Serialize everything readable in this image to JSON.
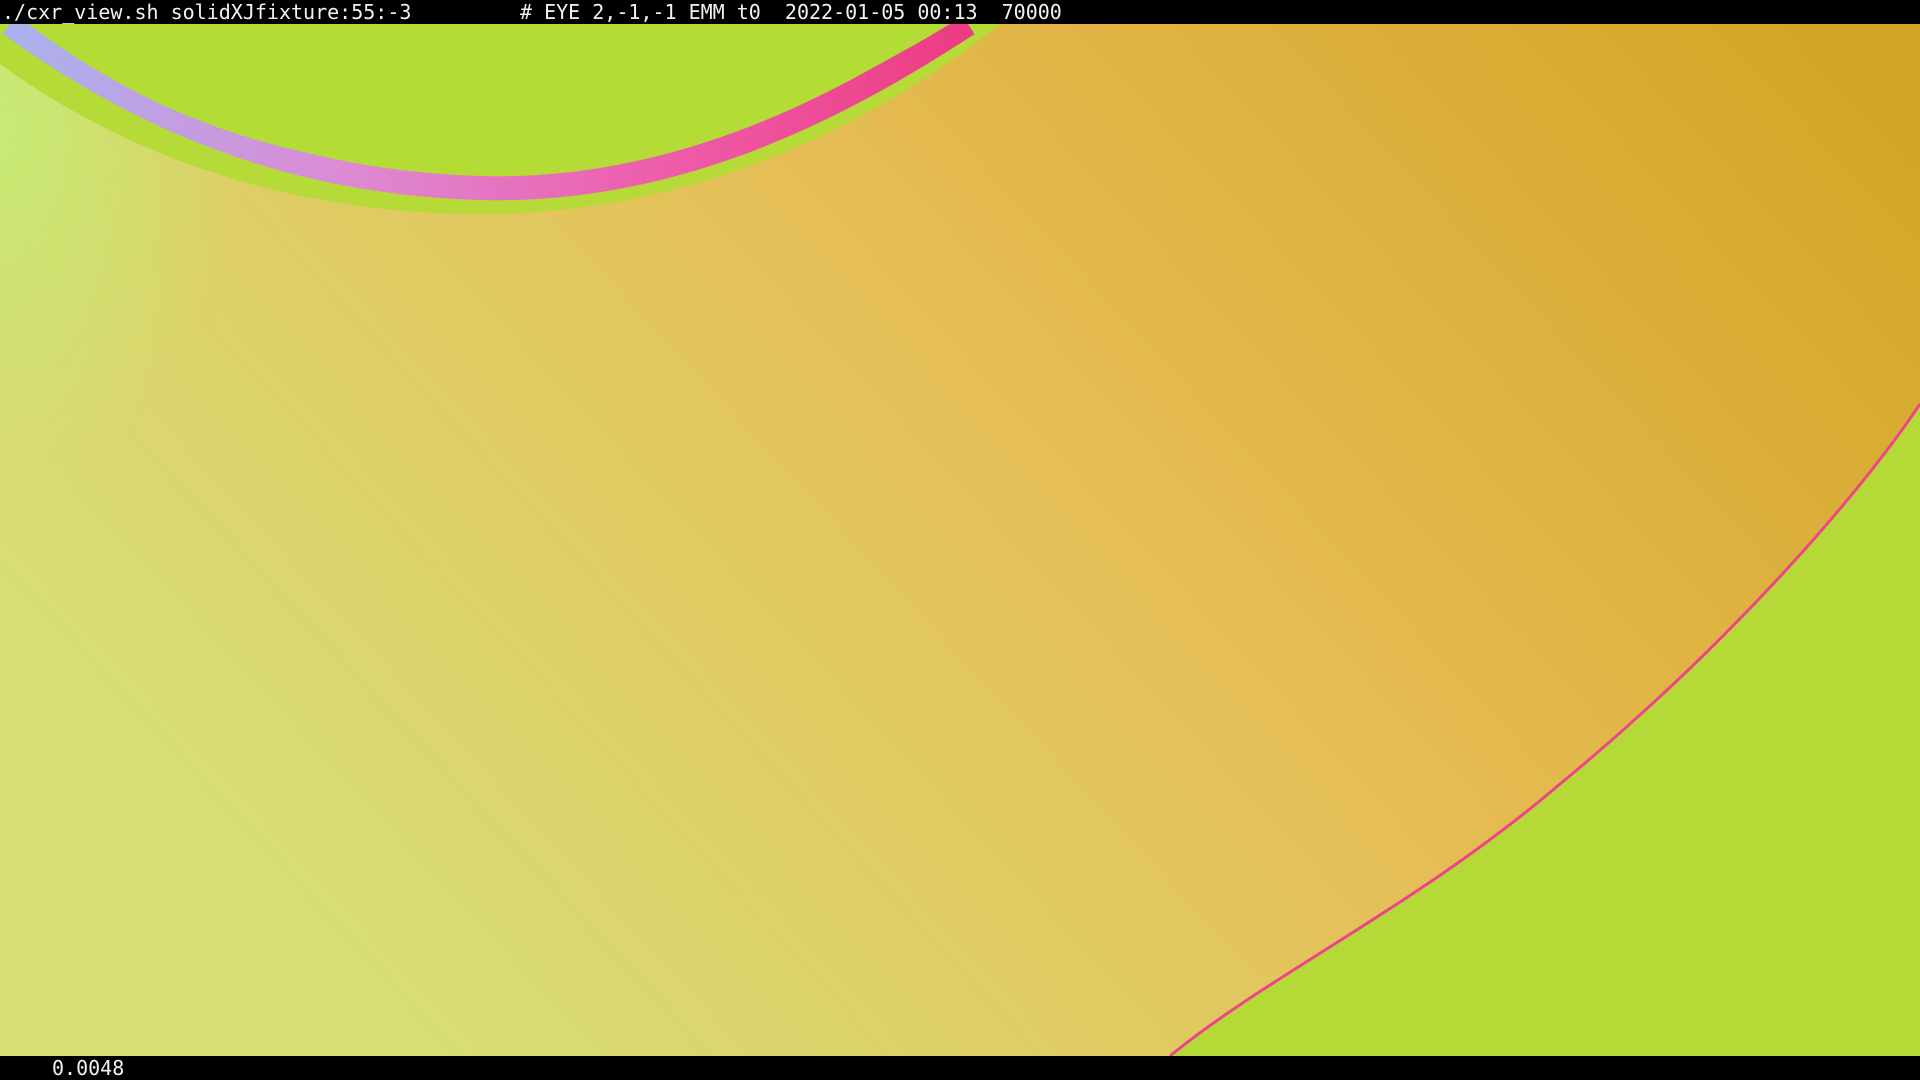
{
  "window": {
    "command": "./cxr_view.sh solidXJfixture:55:-3",
    "meta": "# EYE 2,-1,-1 EMM t0  2022-01-05 00:13  70000"
  },
  "status": {
    "frame_time": "0.0048"
  },
  "colors": {
    "background_green": "#b5da38",
    "surface_gold_light": "#d7de76",
    "surface_gold_mid": "#e6bd55",
    "surface_gold_dark": "#d3a424",
    "rim_pink": "#ef4488",
    "rim_lavender": "#a9b2ee",
    "light_green_edge": "#c6eb74"
  }
}
